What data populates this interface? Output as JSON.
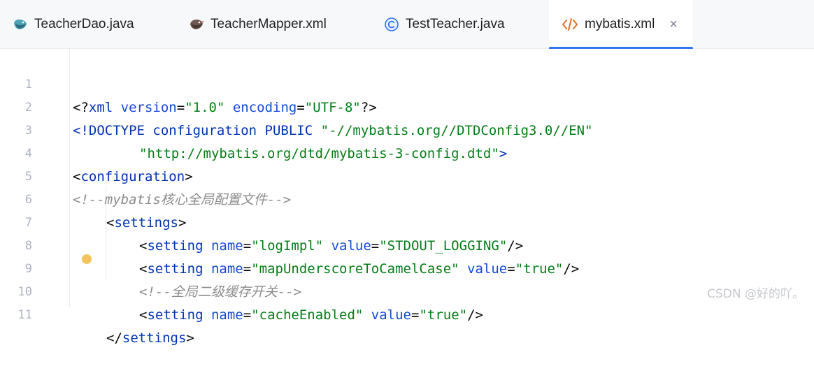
{
  "tabs": [
    {
      "label": "TeacherDao.java",
      "icon": "mybatis-bird-icon"
    },
    {
      "label": "TeacherMapper.xml",
      "icon": "mybatis-bird-icon"
    },
    {
      "label": "TestTeacher.java",
      "icon": "class-c-icon"
    },
    {
      "label": "mybatis.xml",
      "icon": "xml-tag-icon",
      "active": true,
      "close": "×"
    }
  ],
  "editor": {
    "line_numbers": [
      "1",
      "2",
      "3",
      "4",
      "5",
      "6",
      "7",
      "8",
      "9",
      "10",
      "11"
    ],
    "lines": {
      "l1": {
        "open": "<?",
        "tag": "xml",
        "a1": " version",
        "eq1": "=",
        "v1": "\"1.0\"",
        "a2": " encoding",
        "eq2": "=",
        "v2": "\"UTF-8\"",
        "close": "?>"
      },
      "l2": {
        "open": "<!DOCTYPE ",
        "k1": "configuration",
        "k2": " PUBLIC ",
        "s1": "\"-//mybatis.org//DTDConfig3.0//EN\""
      },
      "l3": {
        "s1": "\"http://mybatis.org/dtd/mybatis-3-config.dtd\"",
        "close": ">"
      },
      "l4": {
        "open": "<",
        "tag": "configuration",
        "close": ">"
      },
      "l5": {
        "comment": "<!--mybatis核心全局配置文件-->"
      },
      "l6": {
        "open": "<",
        "tag": "settings",
        "close": ">"
      },
      "l7": {
        "open": "<",
        "tag": "setting",
        "a1": " name",
        "eq1": "=",
        "v1": "\"logImpl\"",
        "a2": " value",
        "eq2": "=",
        "v2": "\"STDOUT_LOGGING\"",
        "close": "/>"
      },
      "l8": {
        "open": "<",
        "tag": "setting",
        "a1": " name",
        "eq1": "=",
        "v1": "\"mapUnderscoreToCamelCase\"",
        "a2": " value",
        "eq2": "=",
        "v2": "\"true\"",
        "close": "/>"
      },
      "l9": {
        "comment": "<!--全局二级缓存开关-->"
      },
      "l10": {
        "open": "<",
        "tag": "setting",
        "a1": " name",
        "eq1": "=",
        "v1": "\"cacheEnabled\"",
        "a2": " value",
        "eq2": "=",
        "v2": "\"true\"",
        "close": "/>"
      },
      "l11": {
        "open": "</",
        "tag": "settings",
        "close": ">"
      }
    }
  },
  "watermark": "CSDN @好的吖。",
  "colors": {
    "tag": "#0033b3",
    "attr": "#174ad4",
    "string": "#067d17",
    "comment": "#8c8c8c",
    "active_tab_underline": "#3574f0"
  }
}
